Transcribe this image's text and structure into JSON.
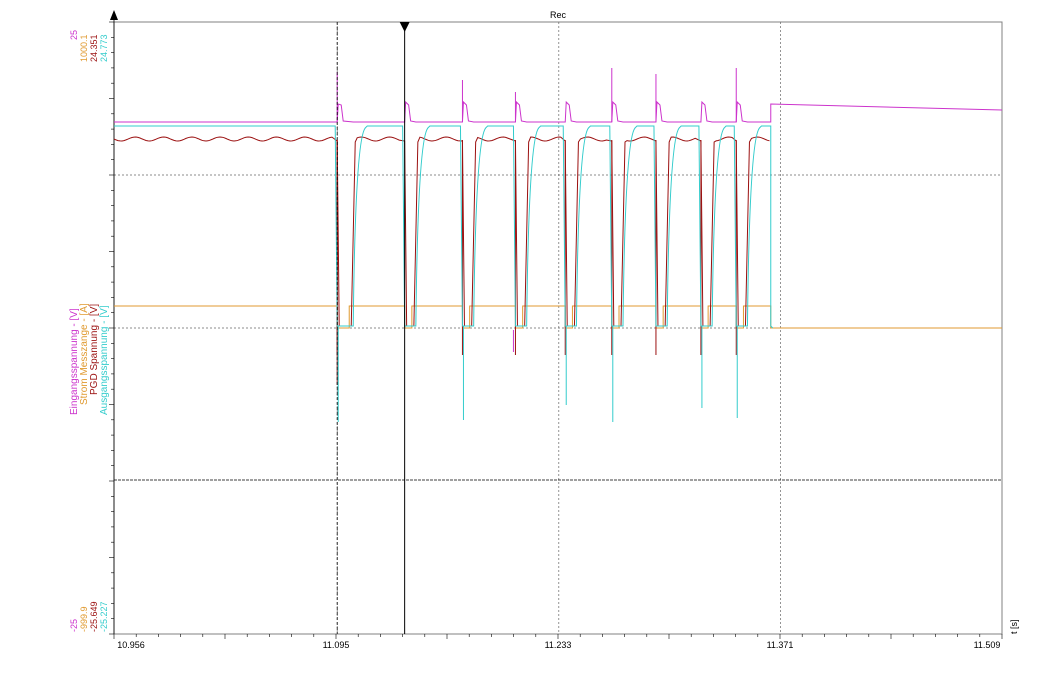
{
  "chart_data": {
    "type": "line",
    "title": "Rec",
    "xlabel": "t [s]",
    "x_ticks": [
      "10.956",
      "11.095",
      "11.233",
      "11.371",
      "11.509"
    ],
    "xlim": [
      10.956,
      11.509
    ],
    "cursor_x": 11.137,
    "marker_x": 11.095,
    "grid": true,
    "series": [
      {
        "name": "Eingangsspannung - [V]",
        "color": "#cc33cc",
        "scale_max": "25",
        "scale_min": "-25"
      },
      {
        "name": "Strom Messzange - [A]",
        "color": "#e09a30",
        "scale_max": "1000.1",
        "scale_min": "-999.9"
      },
      {
        "name": "PGD Spannung - [V]",
        "color": "#9b1010",
        "scale_max": "24.351",
        "scale_min": "-25.649"
      },
      {
        "name": "Ausgangsspannung - [V]",
        "color": "#33cccc",
        "scale_max": "24.773",
        "scale_min": "-25.227"
      }
    ],
    "pulses": [
      {
        "start": 11.095,
        "end": 11.1,
        "spike": true
      },
      {
        "start": 11.137,
        "end": 11.139
      },
      {
        "start": 11.173,
        "end": 11.175,
        "spike": true
      },
      {
        "start": 11.206,
        "end": 11.208,
        "spike": true
      },
      {
        "start": 11.237,
        "end": 11.239,
        "spike": true
      },
      {
        "start": 11.266,
        "end": 11.268,
        "spike": true
      },
      {
        "start": 11.2935,
        "end": 11.2955,
        "spike": true
      },
      {
        "start": 11.3215,
        "end": 11.3235,
        "spike": true
      },
      {
        "start": 11.3435,
        "end": 11.3455,
        "spike": true
      }
    ],
    "on_until": 11.365
  }
}
